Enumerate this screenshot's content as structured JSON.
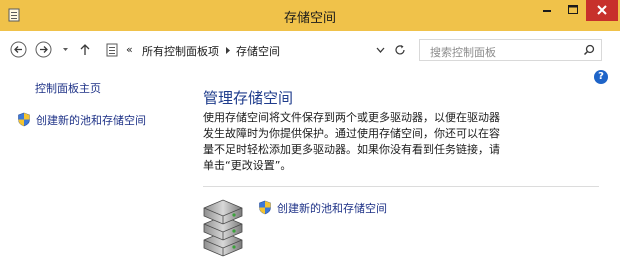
{
  "window": {
    "title": "存储空间",
    "minimize_glyph": "–",
    "maximize_glyph": "□",
    "close_glyph": "×"
  },
  "nav": {
    "breadcrumb_sep": "«",
    "breadcrumb": [
      "所有控制面板项",
      "存储空间"
    ],
    "search_placeholder": "搜索控制面板"
  },
  "left_pane": {
    "home_link": "控制面板主页",
    "create_link": "创建新的池和存储空间"
  },
  "main": {
    "heading": "管理存储空间",
    "description": "使用存储空间将文件保存到两个或更多驱动器，以便在驱动器发生故障时为你提供保护。通过使用存储空间，你还可以在容量不足时轻松添加更多驱动器。如果你没有看到任务链接，请单击“更改设置”。",
    "create_link": "创建新的池和存储空间",
    "help_glyph": "?"
  },
  "colors": {
    "titlebar": "#f0c24a",
    "close_button": "#c7302b",
    "link": "#1e3287",
    "heading": "#1f3c8c"
  }
}
